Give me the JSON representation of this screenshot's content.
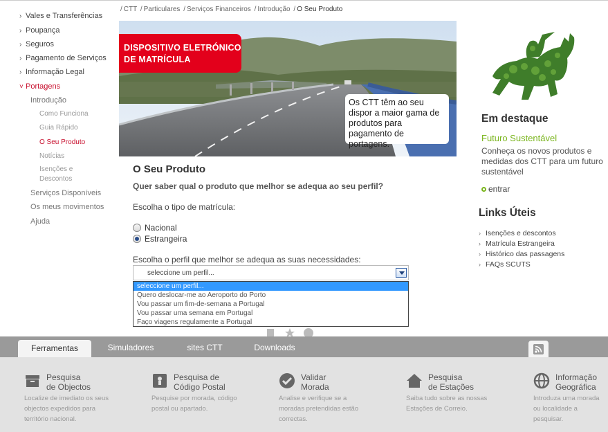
{
  "sidebar": {
    "items": [
      {
        "label": "Vales e Transferências"
      },
      {
        "label": "Poupança"
      },
      {
        "label": "Seguros"
      },
      {
        "label": "Pagamento de Serviços"
      },
      {
        "label": "Informação Legal"
      },
      {
        "label": "Portagens"
      }
    ],
    "sub": [
      {
        "label": "Introdução"
      },
      {
        "label": "Como Funciona"
      },
      {
        "label": "Guia Rápido"
      },
      {
        "label": "O Seu Produto"
      },
      {
        "label": "Notícias"
      },
      {
        "label": "Isenções e"
      },
      {
        "label": "Descontos"
      },
      {
        "label": "Serviços Disponíveis"
      },
      {
        "label": "Os meus movimentos"
      },
      {
        "label": "Ajuda"
      }
    ]
  },
  "breadcrumb": [
    "CTT",
    "Particulares",
    "Serviços Financeiros",
    "Introdução",
    "O Seu Produto"
  ],
  "hero": {
    "badge_line1": "DISPOSITIVO ELETRÓNICO",
    "badge_line2": "DE MATRÍCULA",
    "caption": "Os CTT têm ao seu dispor a maior gama de produtos para pagamento de portagens."
  },
  "main": {
    "title": "O Seu Produto",
    "subtitle": "Quer saber qual o produto que melhor se adequa ao seu perfil?",
    "plate_label": "Escolha o tipo de matrícula:",
    "radio_nacional": "Nacional",
    "radio_estrangeira": "Estrangeira",
    "profile_label": "Escolha o perfil que melhor se adequa as suas necessidades:",
    "select_value": "seleccione um perfil...",
    "options": [
      "seleccione um perfil...",
      "Quero deslocar-me ao Aeroporto do Porto",
      "Vou passar um fim-de-semana a Portugal",
      "Vou passar uma semana em Portugal",
      "Faço viagens regulamente a Portugal"
    ]
  },
  "right": {
    "destaque_title": "Em destaque",
    "destaque_sub": "Futuro Sustentável",
    "destaque_text": "Conheça os novos produtos e medidas dos CTT para um futuro sustentável",
    "entrar": "entrar",
    "links_title": "Links Úteis",
    "links": [
      "Isenções e descontos",
      "Matrícula Estrangeira",
      "Histórico das passagens",
      "FAQs SCUTS"
    ]
  },
  "footer": {
    "tabs": [
      "Ferramentas",
      "Simuladores",
      "sites CTT",
      "Downloads"
    ],
    "tools": [
      {
        "title1": "Pesquisa",
        "title2": "de Objectos",
        "desc": "Localize de imediato os seus objectos expedidos para território nacional.",
        "icon": "package-icon"
      },
      {
        "title1": "Pesquisa de",
        "title2": "Código Postal",
        "desc": "Pesquise por morada, código postal ou apartado.",
        "icon": "postal-code-icon"
      },
      {
        "title1": "Validar",
        "title2": "Morada",
        "desc": "Analise e verifique se a moradas pretendidas estão correctas.",
        "icon": "check-icon"
      },
      {
        "title1": "Pesquisa",
        "title2": "de Estações",
        "desc": "Saiba tudo sobre as nossas Estações de Correio.",
        "icon": "house-icon"
      },
      {
        "title1": "Informação",
        "title2": "Geográfica",
        "desc": "Introduza uma morada ou localidade a pesquisar.",
        "icon": "globe-icon"
      }
    ]
  },
  "colors": {
    "brand_red": "#e3001b",
    "accent_green": "#7ab51d",
    "footer_bar": "#9a9a9a"
  }
}
